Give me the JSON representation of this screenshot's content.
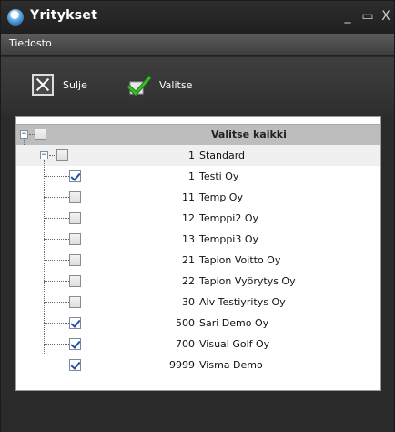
{
  "window": {
    "title": "Yritykset",
    "minimize": "_",
    "maximize": "▭",
    "close": "X"
  },
  "menu": {
    "items": [
      "Tiedosto"
    ]
  },
  "toolbar": {
    "close_label": "Sulje",
    "select_label": "Valitse"
  },
  "tree": {
    "header": {
      "label": "Valitse kaikki",
      "checked": false
    },
    "group": {
      "number": "1",
      "name": "Standard",
      "checked": false
    },
    "companies": [
      {
        "number": "1",
        "name": "Testi Oy",
        "checked": true
      },
      {
        "number": "11",
        "name": "Temp Oy",
        "checked": false
      },
      {
        "number": "12",
        "name": "Temppi2 Oy",
        "checked": false
      },
      {
        "number": "13",
        "name": "Temppi3 Oy",
        "checked": false
      },
      {
        "number": "21",
        "name": "Tapion Voitto Oy",
        "checked": false
      },
      {
        "number": "22",
        "name": "Tapion Vyörytys Oy",
        "checked": false
      },
      {
        "number": "30",
        "name": "Alv Testiyritys Oy",
        "checked": false
      },
      {
        "number": "500",
        "name": "Sari Demo Oy",
        "checked": true
      },
      {
        "number": "700",
        "name": "Visual Golf Oy",
        "checked": true
      },
      {
        "number": "9999",
        "name": "Visma Demo",
        "checked": true
      }
    ]
  },
  "colors": {
    "accent_check": "#1d4ea8",
    "header_bg": "#bdbdbd",
    "window_bg": "#2b2b2b"
  }
}
